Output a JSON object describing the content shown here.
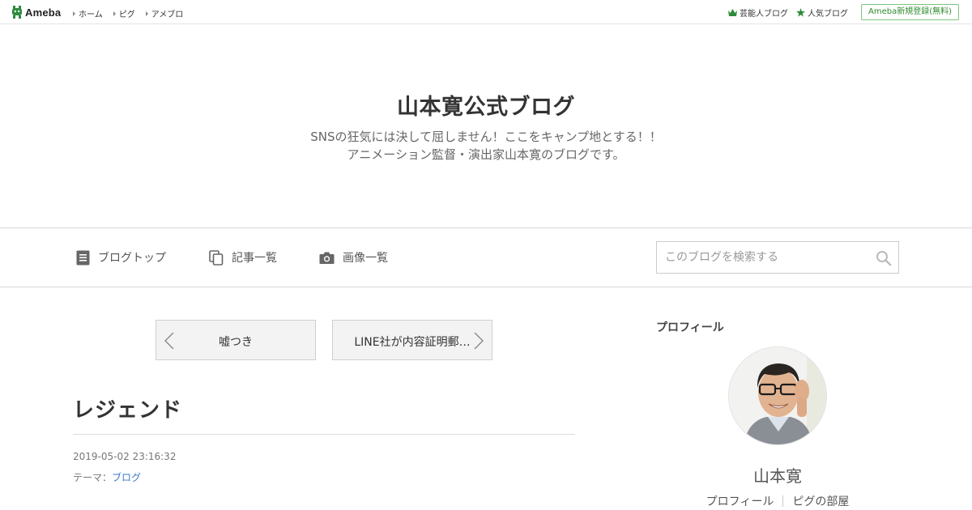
{
  "topbar": {
    "logo_text": "Ameba",
    "nav": [
      "ホーム",
      "ピグ",
      "アメブロ"
    ],
    "celeb_blog": "芸能人ブログ",
    "popular_blog": "人気ブログ",
    "register": "Ameba新規登録(無料)"
  },
  "blog": {
    "title": "山本寛公式ブログ",
    "desc_line1": "SNSの狂気には決して屈しません！ここをキャンプ地とする！！",
    "desc_line2": "アニメーション監督・演出家山本寛のブログです。"
  },
  "blog_nav": {
    "top": "ブログトップ",
    "articles": "記事一覧",
    "images": "画像一覧",
    "search_placeholder": "このブログを検索する"
  },
  "pager": {
    "prev": "嘘つき",
    "next": "LINE社が内容証明郵…"
  },
  "article": {
    "title": "レジェンド",
    "date": "2019-05-02 23:16:32",
    "theme_label": "テーマ：",
    "theme_value": "ブログ"
  },
  "sidebar": {
    "heading": "プロフィール",
    "name": "山本寛",
    "link_profile": "プロフィール",
    "link_room": "ピグの部屋"
  },
  "colors": {
    "ameba_green": "#2d8c3c",
    "link_blue": "#3a78c3"
  }
}
